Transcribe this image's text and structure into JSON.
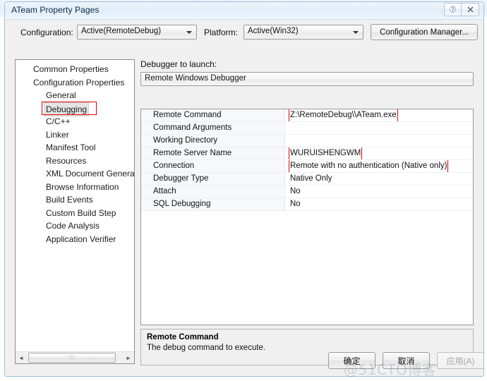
{
  "window": {
    "title": "ATeam Property Pages",
    "help_button": "?",
    "close_button": "✕"
  },
  "config_bar": {
    "configuration_label": "Configuration:",
    "configuration_value": "Active(RemoteDebug)",
    "platform_label": "Platform:",
    "platform_value": "Active(Win32)",
    "config_manager_button": "Configuration Manager..."
  },
  "tree": {
    "items": [
      {
        "label": "Common Properties",
        "level": 0,
        "selected": false
      },
      {
        "label": "Configuration Properties",
        "level": 0,
        "selected": false
      },
      {
        "label": "General",
        "level": 1,
        "selected": false
      },
      {
        "label": "Debugging",
        "level": 1,
        "selected": true
      },
      {
        "label": "C/C++",
        "level": 1,
        "selected": false
      },
      {
        "label": "Linker",
        "level": 1,
        "selected": false
      },
      {
        "label": "Manifest Tool",
        "level": 1,
        "selected": false
      },
      {
        "label": "Resources",
        "level": 1,
        "selected": false
      },
      {
        "label": "XML Document Generat",
        "level": 1,
        "selected": false
      },
      {
        "label": "Browse Information",
        "level": 1,
        "selected": false
      },
      {
        "label": "Build Events",
        "level": 1,
        "selected": false
      },
      {
        "label": "Custom Build Step",
        "level": 1,
        "selected": false
      },
      {
        "label": "Code Analysis",
        "level": 1,
        "selected": false
      },
      {
        "label": "Application Verifier",
        "level": 1,
        "selected": false
      }
    ],
    "scroll_left_icon": "◄",
    "scroll_right_icon": "►",
    "scroll_thumb_grip": "⦙⦙⦙"
  },
  "debugger_section": {
    "label": "Debugger to launch:",
    "value": "Remote Windows Debugger"
  },
  "properties": [
    {
      "name": "Remote Command",
      "value": "Z:\\RemoteDebug\\\\ATeam.exe",
      "highlighted": true
    },
    {
      "name": "Command Arguments",
      "value": "",
      "highlighted": false
    },
    {
      "name": "Working Directory",
      "value": "",
      "highlighted": false
    },
    {
      "name": "Remote Server Name",
      "value": "WURUISHENGWM",
      "highlighted": true
    },
    {
      "name": "Connection",
      "value": "Remote with no authentication (Native only)",
      "highlighted": true
    },
    {
      "name": "Debugger Type",
      "value": "Native Only",
      "highlighted": false
    },
    {
      "name": "Attach",
      "value": "No",
      "highlighted": false
    },
    {
      "name": "SQL Debugging",
      "value": "No",
      "highlighted": false
    }
  ],
  "description": {
    "title": "Remote Command",
    "text": "The debug command to execute."
  },
  "footer": {
    "ok_label": "确定",
    "cancel_label": "取消",
    "apply_label": "应用(A)"
  },
  "watermark": "@51CTO博客",
  "colors": {
    "annotation": "#e00000",
    "window_border": "#9dc0de",
    "dialog_face": "#f0f0f0",
    "grid_name_bg": "#f7f8fb",
    "selection_bg": "#e4e4e4"
  }
}
